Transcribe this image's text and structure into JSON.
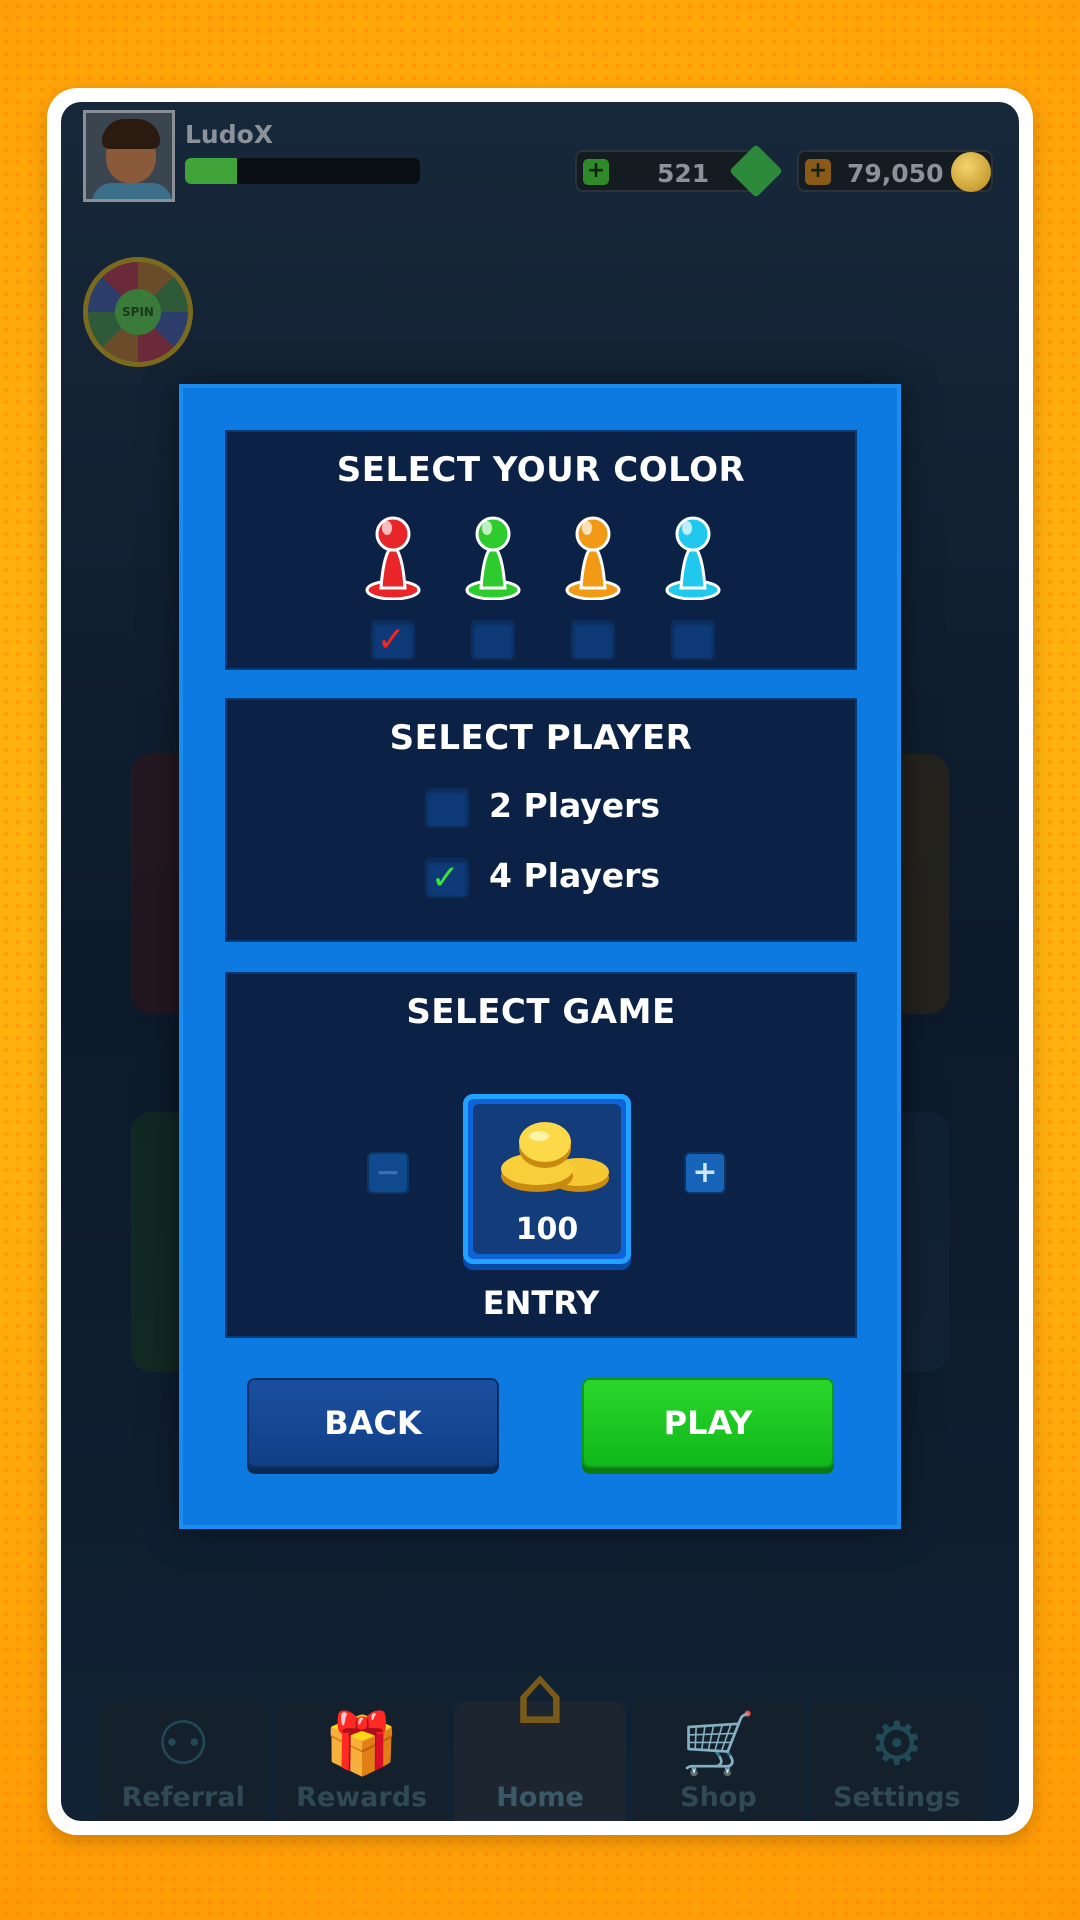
{
  "player": {
    "name": "LudoX",
    "xp_progress": 0.22
  },
  "currency": {
    "gems": "521",
    "coins": "79,050",
    "gem_add_label": "+",
    "coin_add_label": "+"
  },
  "spin": {
    "label": "SPIN"
  },
  "color_section": {
    "title": "SELECT YOUR COLOR",
    "pawns": [
      {
        "color": "#e8262a",
        "selected": true
      },
      {
        "color": "#2ecb2e",
        "selected": false
      },
      {
        "color": "#f29a16",
        "selected": false
      },
      {
        "color": "#1fc8ec",
        "selected": false
      }
    ],
    "check_mark": "✓"
  },
  "player_section": {
    "title": "SELECT PLAYER",
    "options": [
      {
        "label": "2 Players",
        "selected": false
      },
      {
        "label": "4 Players",
        "selected": true
      }
    ],
    "check_mark": "✓"
  },
  "game_section": {
    "title": "SELECT GAME",
    "minus_label": "−",
    "plus_label": "+",
    "entry_amount": "100",
    "entry_label": "ENTRY"
  },
  "buttons": {
    "back": "BACK",
    "play": "PLAY"
  },
  "nav": {
    "items": [
      {
        "label": "Referral",
        "icon": "referral-icon",
        "glyph": "⚇"
      },
      {
        "label": "Rewards",
        "icon": "gift-icon",
        "glyph": "🎁"
      },
      {
        "label": "Home",
        "icon": "home-icon",
        "glyph": "⌂",
        "active": true
      },
      {
        "label": "Shop",
        "icon": "cart-icon",
        "glyph": "🛒"
      },
      {
        "label": "Settings",
        "icon": "gear-icon",
        "glyph": "⚙"
      }
    ]
  },
  "colors": {
    "dialog_bg": "#0c7ae0",
    "panel_bg": "#0b2246",
    "play_green": "#1bc41f",
    "back_blue": "#154a96"
  }
}
